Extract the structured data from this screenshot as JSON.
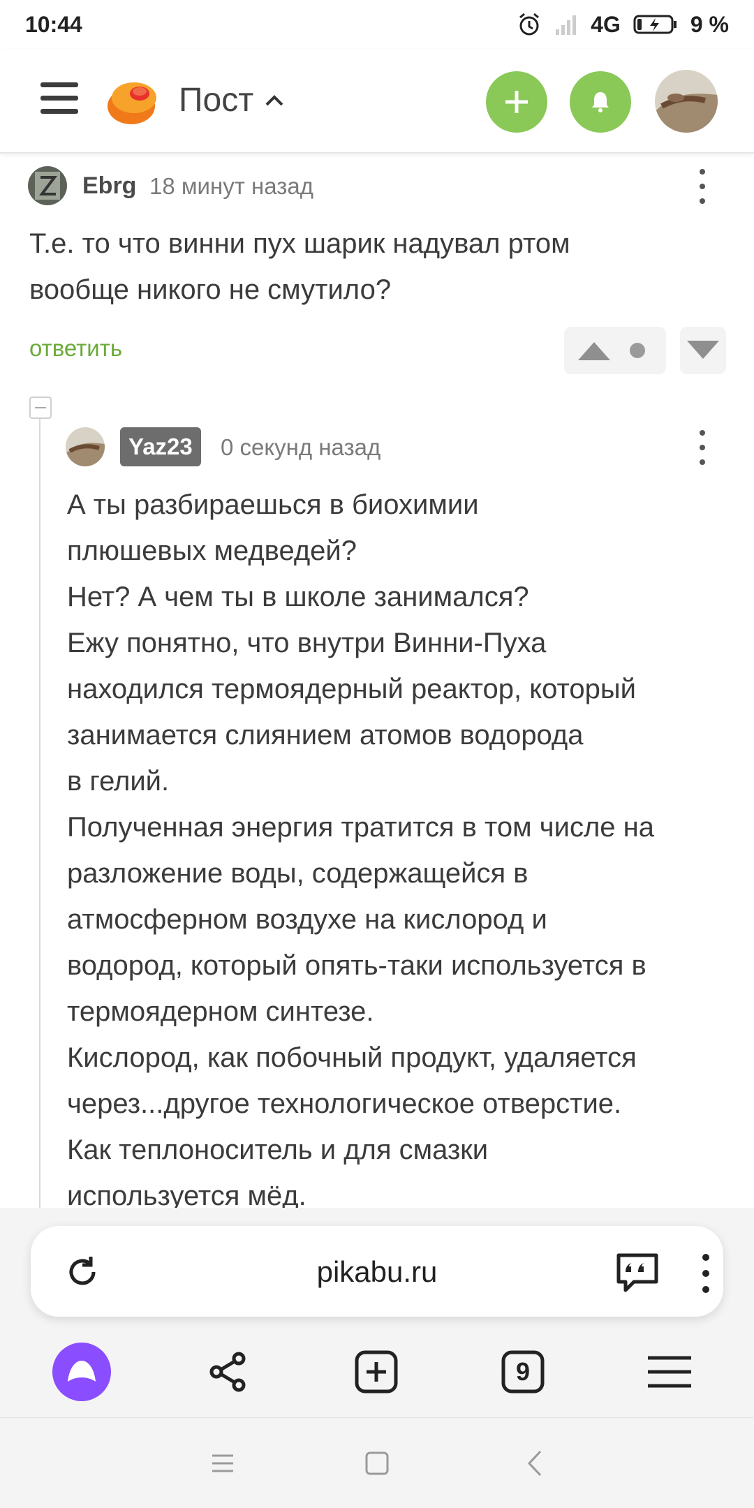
{
  "status_bar": {
    "time": "10:44",
    "network": "4G",
    "battery": "9 %"
  },
  "header": {
    "title": "Пост"
  },
  "comments": [
    {
      "author": "Ebrg",
      "time": "18 минут назад",
      "lines": [
        "Т.е. то что винни пух шарик надувал ртом",
        "вообще никого не смутило?"
      ],
      "reply_label": "ответить"
    },
    {
      "author": "Yaz23",
      "time": "0 секунд назад",
      "lines": [
        "А ты разбираешься в биохимии",
        "плюшевых медведей?",
        "Нет? А чем ты в школе занимался?",
        "Ежу понятно, что внутри Винни-Пуха",
        "находился термоядерный реактор, который",
        "занимается слиянием атомов водорода",
        "в гелий.",
        "Полученная энергия тратится в том числе на",
        "разложение воды, содержащейся в",
        "атмосферном воздухе на кислород и",
        "водород, который опять-таки используется в",
        "термоядерном синтезе.",
        "Кислород, как побочный продукт, удаляется",
        "через...другое технологическое отверстие.",
        "Как теплоноситель и для смазки",
        "используется мёд."
      ]
    }
  ],
  "browser": {
    "url": "pikabu.ru",
    "tabs_count": "9"
  },
  "colors": {
    "accent_green": "#8ac858",
    "reply_green": "#6aaa3a",
    "alice_purple": "#8a4dff"
  },
  "icons": [
    "menu-icon",
    "pikabu-logo",
    "chevron-up-icon",
    "plus-icon",
    "bell-icon",
    "more-icon",
    "arrow-up-icon",
    "arrow-down-icon",
    "reload-icon",
    "quote-icon",
    "alice-icon",
    "share-icon",
    "new-tab-icon",
    "tabs-icon",
    "hamburger-icon"
  ]
}
